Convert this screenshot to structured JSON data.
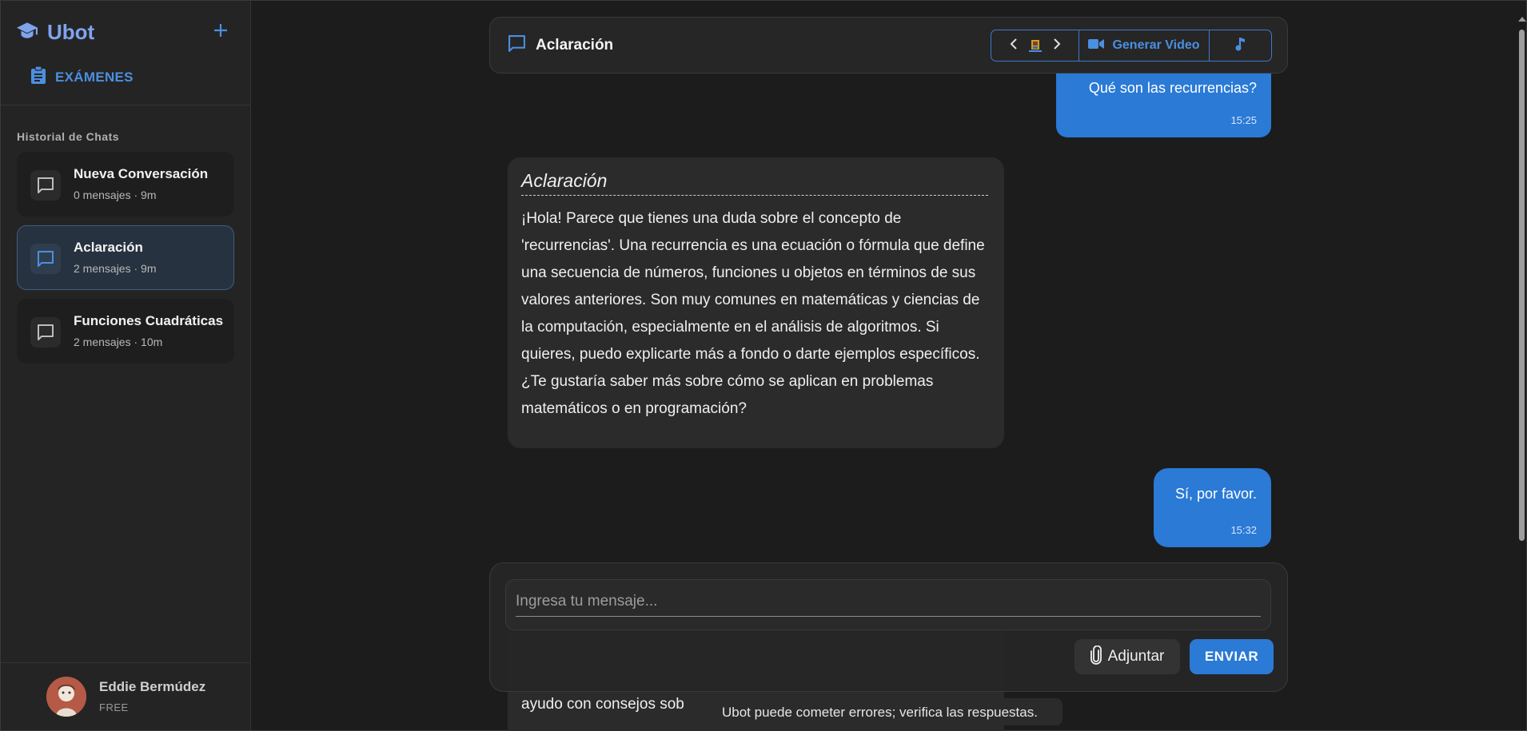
{
  "app": {
    "name": "Ubot",
    "accent": "#2a7ad6"
  },
  "sidebar": {
    "exams_label": "EXÁMENES",
    "history_title": "Historial de Chats",
    "chats": [
      {
        "title": "Nueva Conversación",
        "meta": "0 mensajes · 9m",
        "active": false
      },
      {
        "title": "Aclaración",
        "meta": "2 mensajes · 9m",
        "active": true
      },
      {
        "title": "Funciones Cuadráticas",
        "meta": "2 mensajes · 10m",
        "active": false
      }
    ],
    "user": {
      "name": "Eddie Bermúdez",
      "plan": "FREE"
    }
  },
  "header": {
    "title": "Aclaración",
    "video_label": "Generar Video"
  },
  "messages": {
    "user1": {
      "text": "Qué son las recurrencias?",
      "time": "15:25"
    },
    "bot1": {
      "title": "Aclaración",
      "text": "¡Hola! Parece que tienes una duda sobre el concepto de 'recurrencias'. Una recurrencia es una ecuación o fórmula que define una secuencia de números, funciones u objetos en términos de sus valores anteriores. Son muy comunes en matemáticas y ciencias de la computación, especialmente en el análisis de algoritmos. Si quieres, puedo explicarte más a fondo o darte ejemplos específicos. ¿Te gustaría saber más sobre cómo se aplican en problemas matemáticos o en programación?"
    },
    "user2": {
      "text": "Sí, por favor.",
      "time": "15:32"
    },
    "bot2_partial": "ayudo con consejos sob"
  },
  "composer": {
    "placeholder": "Ingresa tu mensaje...",
    "attach_label": "Adjuntar",
    "send_label": "ENVIAR"
  },
  "disclaimer": "Ubot puede cometer errores; verifica las respuestas."
}
